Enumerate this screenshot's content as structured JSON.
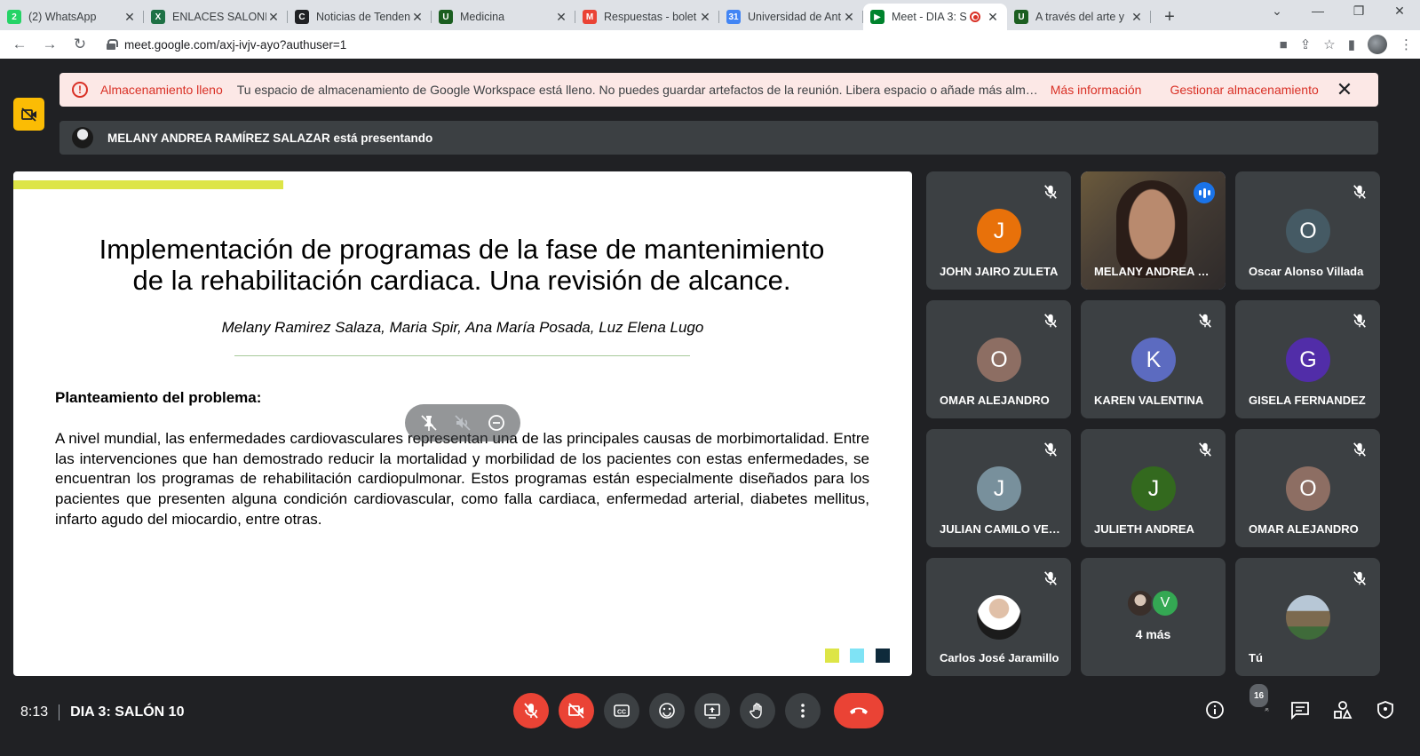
{
  "browser": {
    "tabs": [
      {
        "title": "(2) WhatsApp",
        "fav_color": "#25d366",
        "fav_letter": "2"
      },
      {
        "title": "ENLACES SALONES",
        "fav_color": "#1e7145",
        "fav_letter": "X"
      },
      {
        "title": "Noticias de Tenden",
        "fav_color": "#202124",
        "fav_letter": "C"
      },
      {
        "title": "Medicina",
        "fav_color": "#1b5e20",
        "fav_letter": "U"
      },
      {
        "title": "Respuestas - bolet",
        "fav_color": "#ea4335",
        "fav_letter": "M"
      },
      {
        "title": "Universidad de Ant",
        "fav_color": "#4285f4",
        "fav_letter": "31"
      },
      {
        "title": "Meet - DIA 3: S",
        "fav_color": "#00832d",
        "fav_letter": "▶",
        "active": true
      },
      {
        "title": "A través del arte y",
        "fav_color": "#1b5e20",
        "fav_letter": "U"
      }
    ],
    "url": "meet.google.com/axj-ivjv-ayo?authuser=1"
  },
  "banner": {
    "title": "Almacenamiento lleno",
    "message": "Tu espacio de almacenamiento de Google Workspace está lleno. No puedes guardar artefactos de la reunión. Libera espacio o añade más almacenamiento.",
    "link1": "Más información",
    "link2": "Gestionar almacenamiento"
  },
  "presenting": {
    "text": "MELANY ANDREA RAMÍREZ SALAZAR está presentando"
  },
  "slide": {
    "title_line1": "Implementación de programas de la fase de mantenimiento",
    "title_line2": "de la rehabilitación cardiaca. Una revisión de alcance.",
    "authors": "Melany Ramirez Salaza, Maria Spir, Ana María Posada, Luz Elena Lugo",
    "section_title": "Planteamiento del problema:",
    "body": "A nivel mundial, las enfermedades cardiovasculares representan una de las principales causas de morbimortalidad. Entre las intervenciones que han demostrado reducir la mortalidad y morbilidad de los pacientes con estas enfermedades, se encuentran los programas de rehabilitación cardiopulmonar. Estos programas están especialmente diseñados para los pacientes que presenten alguna condición cardiovascular, como falla cardiaca, enfermedad arterial, diabetes mellitus, infarto agudo del miocardio, entre otras.",
    "squares": [
      "#dde547",
      "#7fe3f5",
      "#0e2a3b"
    ]
  },
  "participants": [
    {
      "name": "JOHN JAIRO ZULETA",
      "initial": "J",
      "color": "#e8710a"
    },
    {
      "name": "MELANY ANDREA RAMÍREZ",
      "video": true
    },
    {
      "name": "Oscar Alonso Villada",
      "initial": "O",
      "color": "#455a64"
    },
    {
      "name": "OMAR ALEJANDRO",
      "initial": "O",
      "color": "#8d6e63"
    },
    {
      "name": "KAREN VALENTINA",
      "initial": "K",
      "color": "#5c6bc0"
    },
    {
      "name": "GISELA FERNANDEZ",
      "initial": "G",
      "color": "#512da8"
    },
    {
      "name": "JULIAN CAMILO VELEZ",
      "initial": "J",
      "color": "#78909c"
    },
    {
      "name": "JULIETH ANDREA",
      "initial": "J",
      "color": "#33691e"
    },
    {
      "name": "OMAR ALEJANDRO",
      "initial": "O",
      "color": "#8d6e63"
    },
    {
      "name": "Carlos José Jaramillo",
      "photo": "carlos"
    },
    {
      "more": "4 más",
      "initial": "V"
    },
    {
      "name": "Tú",
      "photo": "tu"
    }
  ],
  "meeting": {
    "time": "8:13",
    "name": "DIA 3: SALÓN 10",
    "participant_count": "16"
  }
}
